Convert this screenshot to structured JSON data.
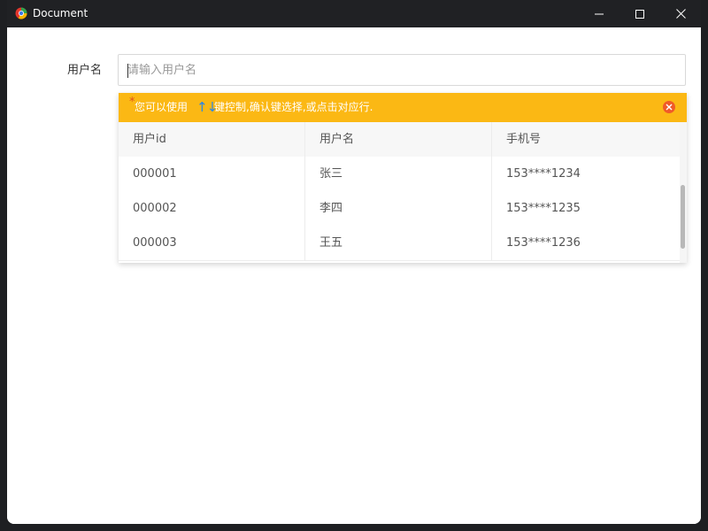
{
  "window": {
    "title": "Document"
  },
  "form": {
    "label": "用户名",
    "placeholder": "请输入用户名"
  },
  "hint": {
    "star": "*",
    "text_before": "您可以使用",
    "arrows": "↑↓",
    "text_after": "键控制,确认键选择,或点击对应行."
  },
  "table": {
    "columns": [
      "用户id",
      "用户名",
      "手机号"
    ],
    "rows": [
      [
        "000001",
        "张三",
        "153****1234"
      ],
      [
        "000002",
        "李四",
        "153****1235"
      ],
      [
        "000003",
        "王五",
        "153****1236"
      ]
    ]
  },
  "colors": {
    "hint_bg": "#fbb814",
    "hint_star": "#e0541e",
    "arrow_accent": "#2a86e8",
    "close_icon": "#f05a28",
    "titlebar": "#202124"
  },
  "icons": {
    "app": "browser-app-icon",
    "minimize": "minimize-icon",
    "maximize": "maximize-icon",
    "close": "close-icon",
    "hint_close": "close-circle-icon"
  }
}
